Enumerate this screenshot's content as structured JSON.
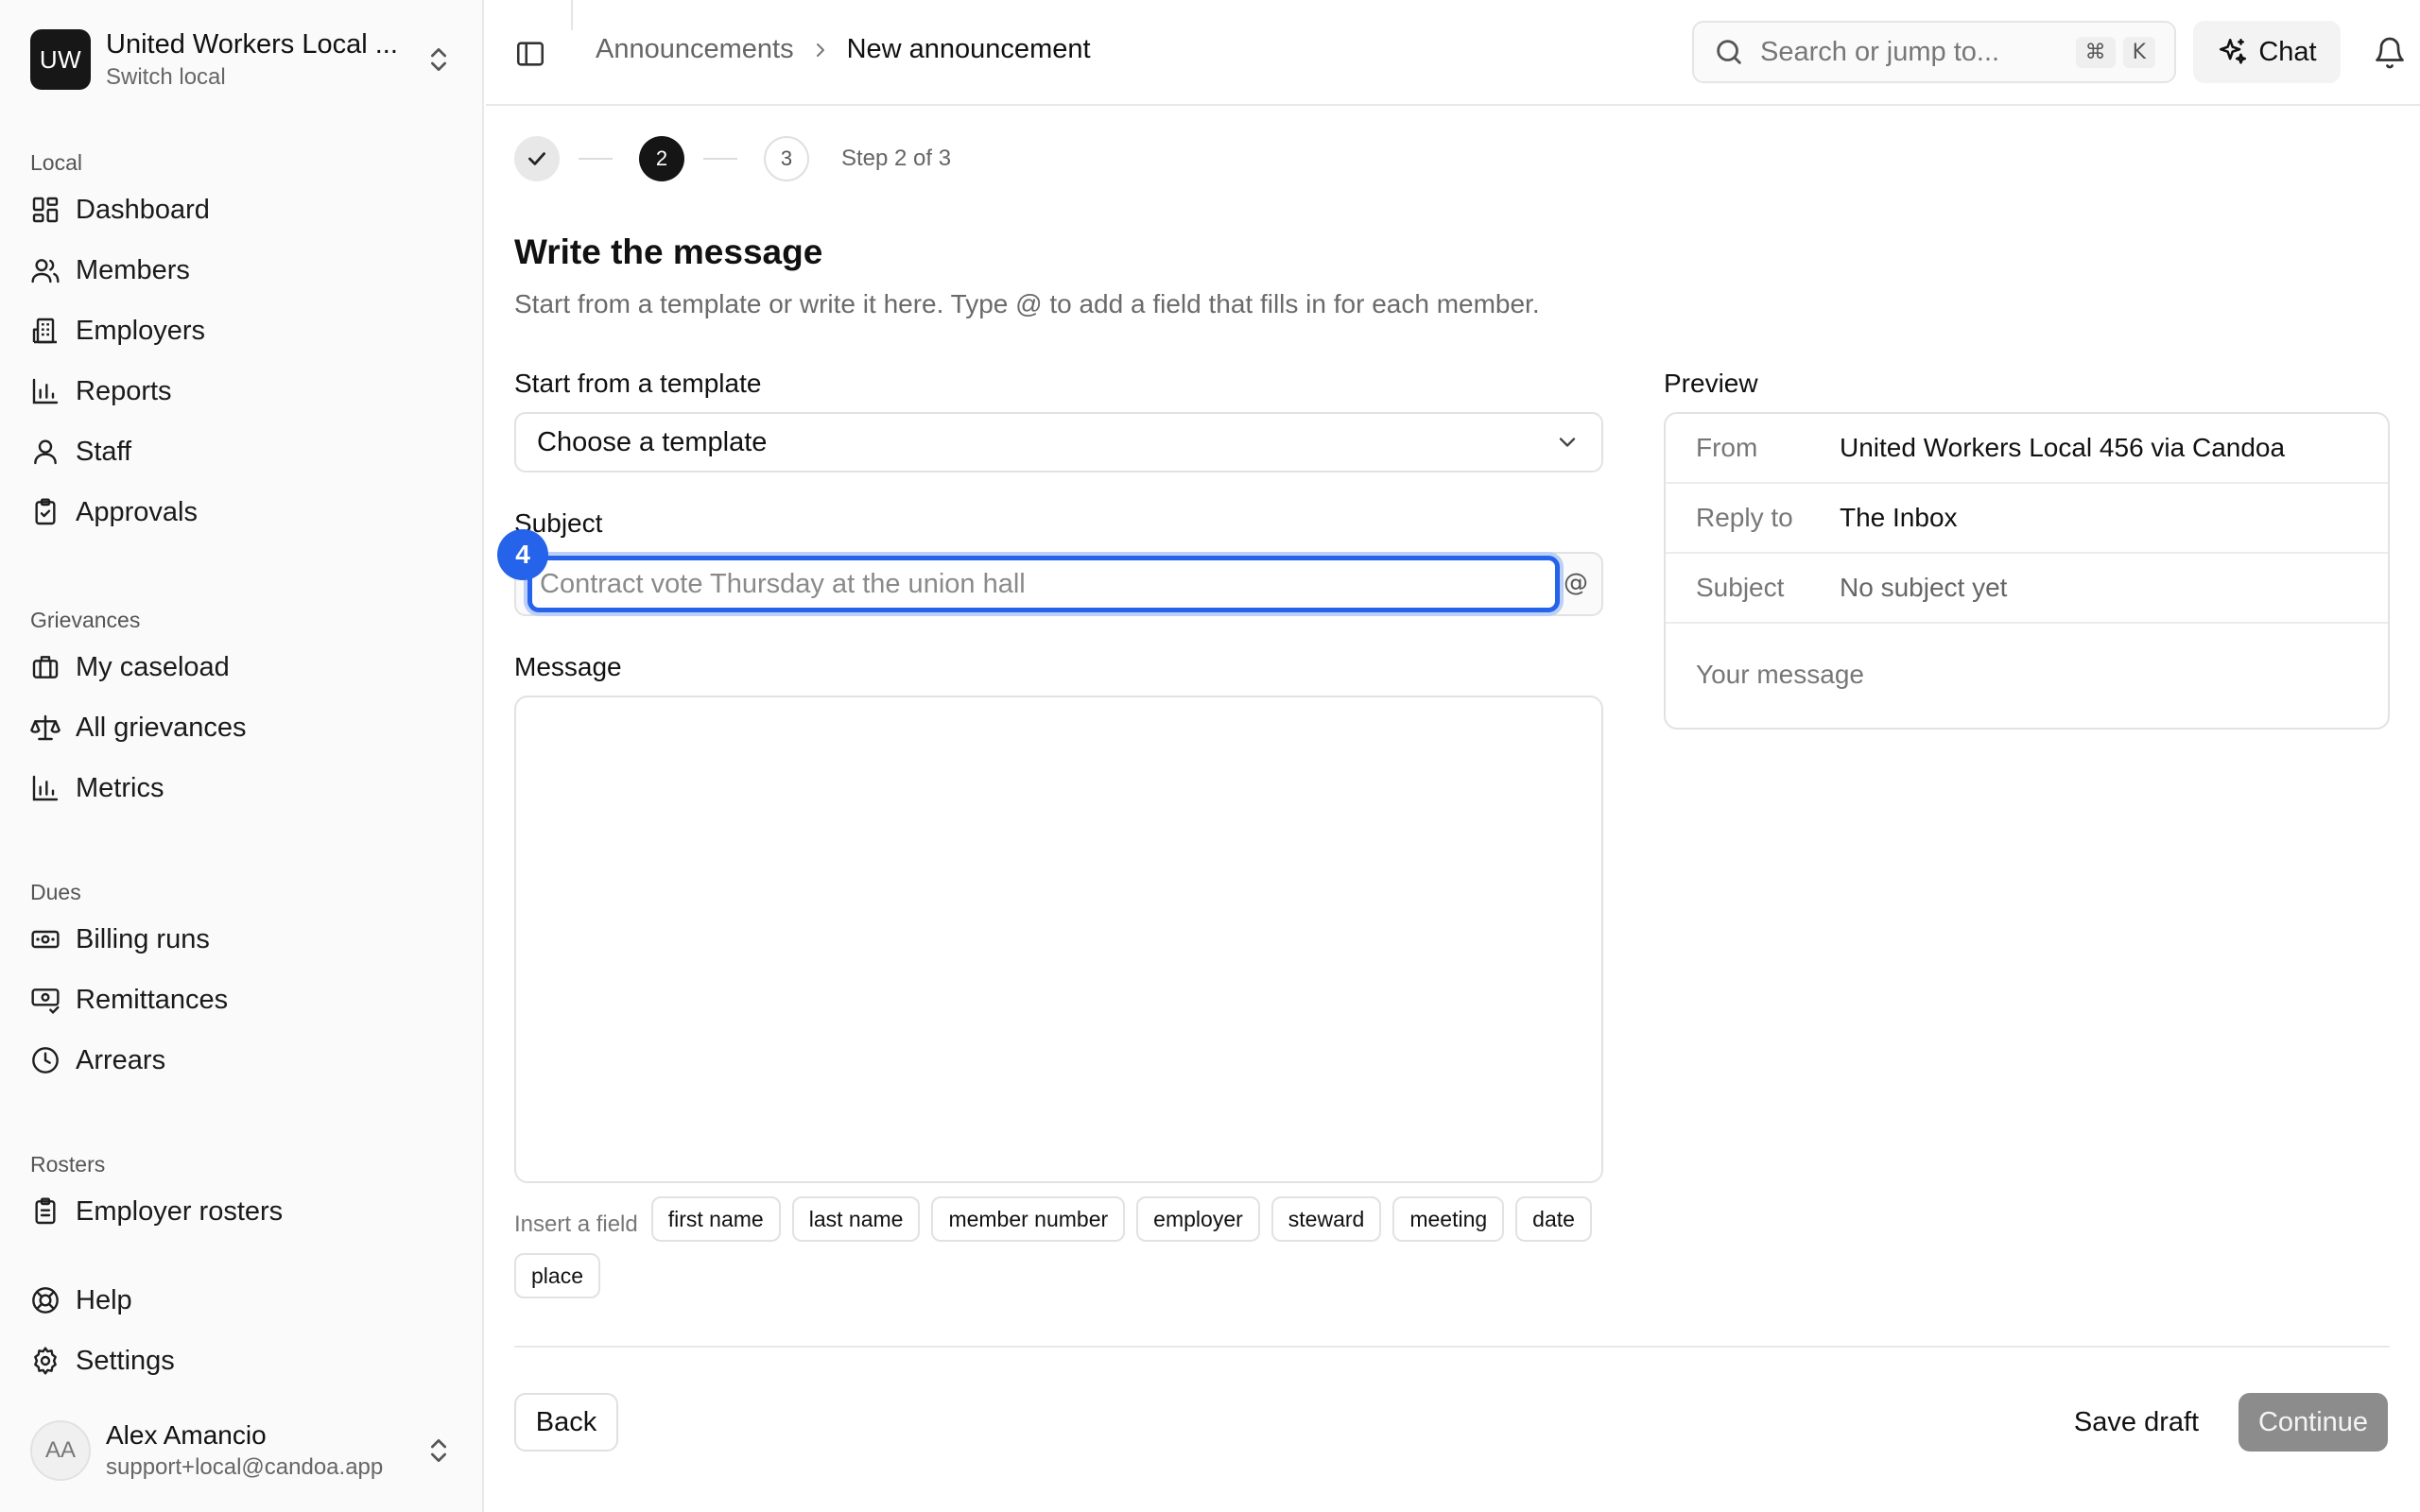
{
  "org": {
    "initials": "UW",
    "name": "United Workers Local ...",
    "subtitle": "Switch local"
  },
  "sidebar": {
    "sections": [
      {
        "heading": "Local",
        "items": [
          {
            "label": "Dashboard",
            "icon": "dashboard-icon"
          },
          {
            "label": "Members",
            "icon": "members-icon"
          },
          {
            "label": "Employers",
            "icon": "building-icon"
          },
          {
            "label": "Reports",
            "icon": "bar-chart-icon"
          },
          {
            "label": "Staff",
            "icon": "user-icon"
          },
          {
            "label": "Approvals",
            "icon": "clipboard-check-icon"
          }
        ]
      },
      {
        "heading": "Grievances",
        "items": [
          {
            "label": "My caseload",
            "icon": "briefcase-icon"
          },
          {
            "label": "All grievances",
            "icon": "scale-icon"
          },
          {
            "label": "Metrics",
            "icon": "bar-chart-icon"
          }
        ]
      },
      {
        "heading": "Dues",
        "items": [
          {
            "label": "Billing runs",
            "icon": "banknote-icon"
          },
          {
            "label": "Remittances",
            "icon": "receipt-icon"
          },
          {
            "label": "Arrears",
            "icon": "clock-icon"
          }
        ]
      },
      {
        "heading": "Rosters",
        "items": [
          {
            "label": "Employer rosters",
            "icon": "clipboard-list-icon"
          }
        ]
      }
    ],
    "bottom_items": [
      {
        "label": "Help",
        "icon": "lifebuoy-icon"
      },
      {
        "label": "Settings",
        "icon": "gear-icon"
      }
    ]
  },
  "user": {
    "initials": "AA",
    "name": "Alex Amancio",
    "email": "support+local@candoa.app"
  },
  "topbar": {
    "breadcrumb_parent": "Announcements",
    "breadcrumb_current": "New announcement",
    "search_placeholder": "Search or jump to...",
    "shortcut_cmd": "⌘",
    "shortcut_key": "K",
    "chat_label": "Chat"
  },
  "stepper": {
    "step2": "2",
    "step3": "3",
    "label": "Step 2 of 3",
    "current": 2,
    "total": 3
  },
  "main": {
    "title": "Write the message",
    "description": "Start from a template or write it here. Type @ to add a field that fills in for each member.",
    "template_label": "Start from a template",
    "template_value": "Choose a template",
    "subject_label": "Subject",
    "subject_placeholder": "Contract vote Thursday at the union hall",
    "subject_at": "@",
    "marker_number": "4",
    "message_label": "Message",
    "insert_label": "Insert a field",
    "fields": [
      "first name",
      "last name",
      "member number",
      "employer",
      "steward",
      "meeting",
      "date",
      "place"
    ]
  },
  "preview": {
    "label": "Preview",
    "from_key": "From",
    "from_value": "United Workers Local 456 via Candoa",
    "reply_key": "Reply to",
    "reply_value": "The Inbox",
    "subject_key": "Subject",
    "subject_value": "No subject yet",
    "body_placeholder": "Your message"
  },
  "footer": {
    "back": "Back",
    "save_draft": "Save draft",
    "continue": "Continue"
  },
  "colors": {
    "accent": "#2563eb",
    "continue_disabled": "#8c8c8c"
  }
}
